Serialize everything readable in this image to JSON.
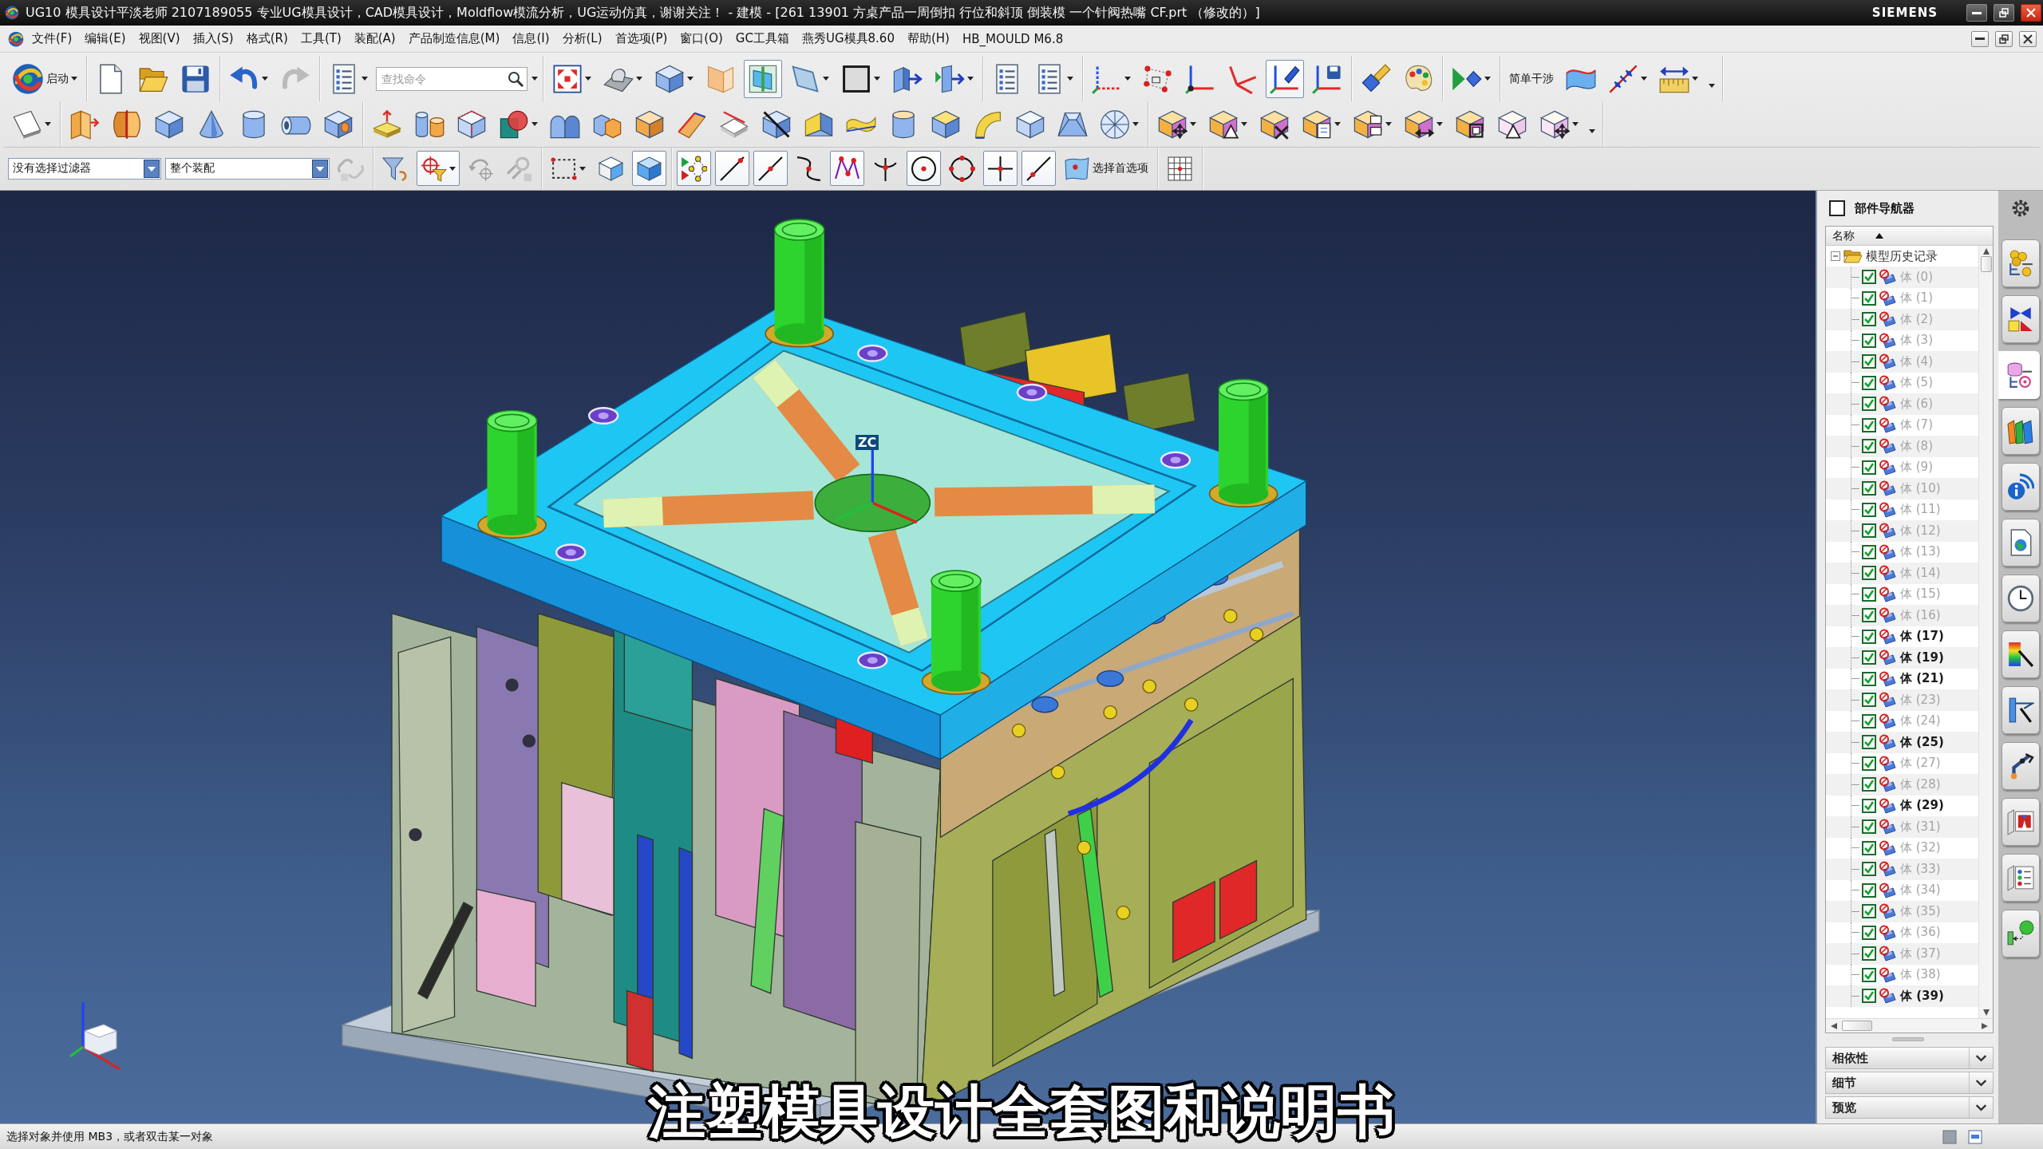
{
  "window": {
    "title": "UG10 模具设计平淡老师 2107189055 专业UG模具设计，CAD模具设计，Moldflow模流分析，UG运动仿真，谢谢关注！ - 建模 - [261 13901 方桌产品一周倒扣 行位和斜顶 倒装模 一个针阀热嘴 CF.prt （修改的）]",
    "brand": "SIEMENS"
  },
  "menu_bar": [
    "文件(F)",
    "编辑(E)",
    "视图(V)",
    "插入(S)",
    "格式(R)",
    "工具(T)",
    "装配(A)",
    "产品制造信息(M)",
    "信息(I)",
    "分析(L)",
    "首选项(P)",
    "窗口(O)",
    "GC工具箱",
    "燕秀UG模具8.60",
    "帮助(H)",
    "HB_MOULD M6.8"
  ],
  "toolbars": [
    {
      "groups": [
        {
          "items": [
            {
              "kind": "menu_button",
              "label": "启动"
            }
          ]
        },
        {
          "items": [
            {
              "kind": "tool",
              "pressed": false,
              "disabled": false
            },
            {
              "kind": "tool",
              "pressed": false,
              "disabled": false
            },
            {
              "kind": "tool",
              "pressed": false,
              "disabled": false
            }
          ]
        },
        {
          "items": [
            {
              "kind": "tool",
              "pressed": false,
              "disabled": false
            },
            {
              "kind": "tool",
              "pressed": false,
              "disabled": true
            }
          ]
        },
        {
          "items": [
            {
              "kind": "tool",
              "pressed": false,
              "disabled": false
            },
            {
              "kind": "search",
              "placeholder": "查找命令"
            }
          ]
        },
        {
          "items": [
            {
              "kind": "tool",
              "pressed": false,
              "disabled": false
            },
            {
              "kind": "tool",
              "pressed": false,
              "disabled": false
            },
            {
              "kind": "tool",
              "pressed": false,
              "disabled": false
            },
            {
              "kind": "tool",
              "pressed": false,
              "disabled": false
            },
            {
              "kind": "tool",
              "pressed": true,
              "disabled": false
            },
            {
              "kind": "tool",
              "pressed": false,
              "disabled": false
            },
            {
              "kind": "tool",
              "pressed": false,
              "disabled": false
            },
            {
              "kind": "tool",
              "pressed": false,
              "disabled": false
            },
            {
              "kind": "tool",
              "pressed": false,
              "disabled": false
            }
          ]
        },
        {
          "items": [
            {
              "kind": "tool",
              "pressed": false,
              "disabled": false
            },
            {
              "kind": "tool",
              "pressed": false,
              "disabled": false
            }
          ]
        },
        {
          "items": [
            {
              "kind": "tool",
              "pressed": false,
              "disabled": false
            },
            {
              "kind": "tool",
              "pressed": false,
              "disabled": false
            },
            {
              "kind": "tool",
              "pressed": false,
              "disabled": false
            },
            {
              "kind": "tool",
              "pressed": false,
              "disabled": false
            },
            {
              "kind": "tool",
              "pressed": true,
              "disabled": false
            },
            {
              "kind": "tool",
              "pressed": false,
              "disabled": false
            }
          ]
        },
        {
          "items": [
            {
              "kind": "tool",
              "pressed": false,
              "disabled": false
            },
            {
              "kind": "tool",
              "pressed": false,
              "disabled": false
            }
          ]
        },
        {
          "items": [
            {
              "kind": "tool",
              "pressed": false,
              "disabled": false
            }
          ]
        },
        {
          "items": [
            {
              "kind": "text_tool",
              "label": "简单干涉"
            },
            {
              "kind": "tool",
              "pressed": false,
              "disabled": false
            },
            {
              "kind": "tool",
              "pressed": false,
              "disabled": false
            },
            {
              "kind": "tool",
              "pressed": false,
              "disabled": false
            },
            {
              "kind": "overflow"
            }
          ]
        }
      ]
    },
    {
      "groups": [
        {
          "items": [
            {
              "kind": "tool",
              "pressed": false,
              "disabled": false
            }
          ]
        },
        {
          "items": [
            {
              "kind": "tool",
              "pressed": false,
              "disabled": false
            },
            {
              "kind": "tool",
              "pressed": false,
              "disabled": false
            },
            {
              "kind": "tool",
              "pressed": false,
              "disabled": false
            },
            {
              "kind": "tool",
              "pressed": false,
              "disabled": false
            },
            {
              "kind": "tool",
              "pressed": false,
              "disabled": false
            },
            {
              "kind": "tool",
              "pressed": false,
              "disabled": false
            },
            {
              "kind": "tool",
              "pressed": false,
              "disabled": false
            }
          ]
        },
        {
          "items": [
            {
              "kind": "tool",
              "pressed": false,
              "disabled": false
            },
            {
              "kind": "tool",
              "pressed": false,
              "disabled": false
            },
            {
              "kind": "tool",
              "pressed": false,
              "disabled": false
            },
            {
              "kind": "tool",
              "pressed": false,
              "disabled": false
            },
            {
              "kind": "tool",
              "pressed": false,
              "disabled": false
            },
            {
              "kind": "tool",
              "pressed": false,
              "disabled": false
            },
            {
              "kind": "tool",
              "pressed": false,
              "disabled": false
            },
            {
              "kind": "tool",
              "pressed": false,
              "disabled": false
            },
            {
              "kind": "tool",
              "pressed": false,
              "disabled": false
            },
            {
              "kind": "tool",
              "pressed": false,
              "disabled": false
            },
            {
              "kind": "tool",
              "pressed": false,
              "disabled": false
            },
            {
              "kind": "tool",
              "pressed": false,
              "disabled": false
            },
            {
              "kind": "tool",
              "pressed": false,
              "disabled": false
            },
            {
              "kind": "tool",
              "pressed": false,
              "disabled": false
            },
            {
              "kind": "tool",
              "pressed": false,
              "disabled": false
            },
            {
              "kind": "tool",
              "pressed": false,
              "disabled": false
            },
            {
              "kind": "tool",
              "pressed": false,
              "disabled": false
            },
            {
              "kind": "tool",
              "pressed": false,
              "disabled": false
            }
          ]
        },
        {
          "items": [
            {
              "kind": "tool",
              "pressed": false,
              "disabled": false
            },
            {
              "kind": "tool",
              "pressed": false,
              "disabled": false
            },
            {
              "kind": "tool",
              "pressed": false,
              "disabled": false
            },
            {
              "kind": "tool",
              "pressed": false,
              "disabled": false
            },
            {
              "kind": "tool",
              "pressed": false,
              "disabled": false
            },
            {
              "kind": "tool",
              "pressed": false,
              "disabled": false
            },
            {
              "kind": "tool",
              "pressed": false,
              "disabled": false
            },
            {
              "kind": "tool",
              "pressed": false,
              "disabled": false
            },
            {
              "kind": "tool",
              "pressed": false,
              "disabled": false
            },
            {
              "kind": "overflow"
            }
          ]
        }
      ]
    },
    {
      "groups": [
        {
          "items": [
            {
              "kind": "dropdown",
              "value": "没有选择过滤器"
            },
            {
              "kind": "dropdown",
              "value": "整个装配"
            },
            {
              "kind": "tool",
              "pressed": false,
              "disabled": true
            }
          ]
        },
        {
          "items": [
            {
              "kind": "tool",
              "pressed": false,
              "disabled": false
            },
            {
              "kind": "tool",
              "pressed": true,
              "disabled": false
            },
            {
              "kind": "tool",
              "pressed": false,
              "disabled": true
            },
            {
              "kind": "tool",
              "pressed": false,
              "disabled": true
            }
          ]
        },
        {
          "items": [
            {
              "kind": "tool",
              "pressed": false,
              "disabled": false
            },
            {
              "kind": "tool",
              "pressed": false,
              "disabled": false
            },
            {
              "kind": "tool",
              "pressed": true,
              "disabled": false
            }
          ]
        },
        {
          "items": [
            {
              "kind": "tool",
              "pressed": true,
              "disabled": false
            },
            {
              "kind": "tool",
              "pressed": true,
              "disabled": false
            },
            {
              "kind": "tool",
              "pressed": true,
              "disabled": false
            },
            {
              "kind": "tool",
              "pressed": false,
              "disabled": false
            },
            {
              "kind": "tool",
              "pressed": true,
              "disabled": false
            },
            {
              "kind": "tool",
              "pressed": false,
              "disabled": false
            },
            {
              "kind": "tool",
              "pressed": true,
              "disabled": false
            },
            {
              "kind": "tool",
              "pressed": false,
              "disabled": false
            },
            {
              "kind": "tool",
              "pressed": true,
              "disabled": false
            },
            {
              "kind": "tool",
              "pressed": true,
              "disabled": false
            },
            {
              "kind": "labeled_tool",
              "label": "选择首选项",
              "pressed": false,
              "disabled": false
            }
          ]
        },
        {
          "items": [
            {
              "kind": "tool",
              "pressed": false,
              "disabled": false
            }
          ]
        }
      ]
    }
  ],
  "viewport": {
    "axis_label": "ZC"
  },
  "part_navigator": {
    "title": "部件导航器",
    "column": "名称",
    "root": {
      "label": "模型历史记录",
      "expanded": true,
      "children": [
        {
          "label": "体 (0)",
          "checked": true,
          "greyed": true
        },
        {
          "label": "体 (1)",
          "checked": true,
          "greyed": true
        },
        {
          "label": "体 (2)",
          "checked": true,
          "greyed": true
        },
        {
          "label": "体 (3)",
          "checked": true,
          "greyed": true
        },
        {
          "label": "体 (4)",
          "checked": true,
          "greyed": true
        },
        {
          "label": "体 (5)",
          "checked": true,
          "greyed": true
        },
        {
          "label": "体 (6)",
          "checked": true,
          "greyed": true
        },
        {
          "label": "体 (7)",
          "checked": true,
          "greyed": true
        },
        {
          "label": "体 (8)",
          "checked": true,
          "greyed": true
        },
        {
          "label": "体 (9)",
          "checked": true,
          "greyed": true
        },
        {
          "label": "体 (10)",
          "checked": true,
          "greyed": true
        },
        {
          "label": "体 (11)",
          "checked": true,
          "greyed": true
        },
        {
          "label": "体 (12)",
          "checked": true,
          "greyed": true
        },
        {
          "label": "体 (13)",
          "checked": true,
          "greyed": true
        },
        {
          "label": "体 (14)",
          "checked": true,
          "greyed": true
        },
        {
          "label": "体 (15)",
          "checked": true,
          "greyed": true
        },
        {
          "label": "体 (16)",
          "checked": true,
          "greyed": true
        },
        {
          "label": "体 (17)",
          "checked": true,
          "greyed": false
        },
        {
          "label": "体 (19)",
          "checked": true,
          "greyed": false
        },
        {
          "label": "体 (21)",
          "checked": true,
          "greyed": false
        },
        {
          "label": "体 (23)",
          "checked": true,
          "greyed": true
        },
        {
          "label": "体 (24)",
          "checked": true,
          "greyed": true
        },
        {
          "label": "体 (25)",
          "checked": true,
          "greyed": false
        },
        {
          "label": "体 (27)",
          "checked": true,
          "greyed": true
        },
        {
          "label": "体 (28)",
          "checked": true,
          "greyed": true
        },
        {
          "label": "体 (29)",
          "checked": true,
          "greyed": false
        },
        {
          "label": "体 (31)",
          "checked": true,
          "greyed": true
        },
        {
          "label": "体 (32)",
          "checked": true,
          "greyed": true
        },
        {
          "label": "体 (33)",
          "checked": true,
          "greyed": true
        },
        {
          "label": "体 (34)",
          "checked": true,
          "greyed": true
        },
        {
          "label": "体 (35)",
          "checked": true,
          "greyed": true
        },
        {
          "label": "体 (36)",
          "checked": true,
          "greyed": true
        },
        {
          "label": "体 (37)",
          "checked": true,
          "greyed": true
        },
        {
          "label": "体 (38)",
          "checked": true,
          "greyed": true
        },
        {
          "label": "体 (39)",
          "checked": true,
          "greyed": false
        }
      ]
    },
    "sections": [
      {
        "label": "相依性",
        "expanded": false
      },
      {
        "label": "细节",
        "expanded": false
      },
      {
        "label": "预览",
        "expanded": false
      }
    ]
  },
  "resource_tabs": [
    {
      "selected": false
    },
    {
      "selected": false
    },
    {
      "selected": true
    },
    {
      "selected": false
    },
    {
      "selected": false
    },
    {
      "selected": false
    },
    {
      "selected": false
    },
    {
      "selected": false
    },
    {
      "selected": false
    },
    {
      "selected": false
    },
    {
      "selected": false
    },
    {
      "selected": false
    },
    {
      "selected": false
    }
  ],
  "status_bar": {
    "message": "选择对象并使用 MB3，或者双击某一对象"
  },
  "subtitle": "注塑模具设计全套图和说明书"
}
